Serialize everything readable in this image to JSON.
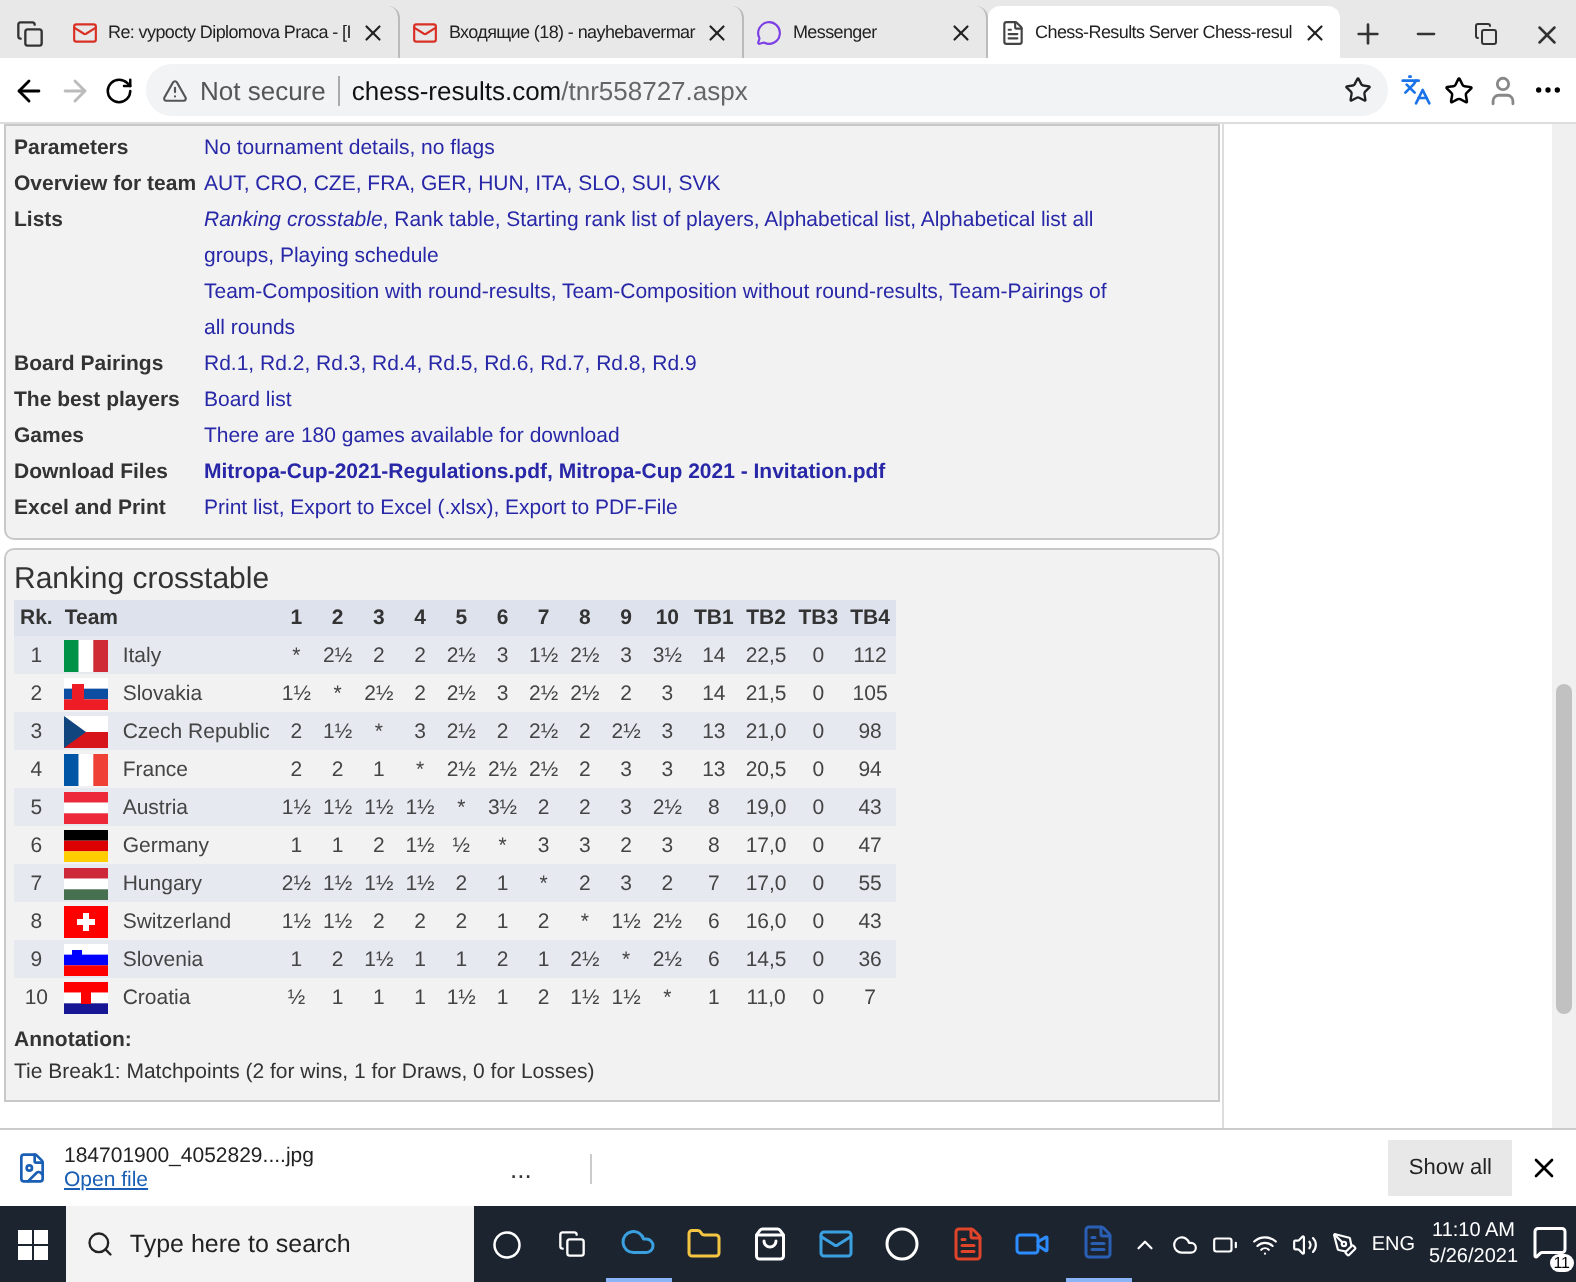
{
  "browser": {
    "tabs": [
      {
        "title": "Re: vypocty Diplomova Praca - [I",
        "selected": false
      },
      {
        "title": "Входящие (18) - nayhebavermar",
        "selected": false
      },
      {
        "title": "Messenger",
        "selected": false
      },
      {
        "title": "Chess-Results Server Chess-resul",
        "selected": true
      }
    ],
    "security": "Not secure",
    "url_host": "chess-results.com",
    "url_path": "/tnr558727.aspx"
  },
  "info_rows": [
    {
      "label": "Parameters",
      "lines": [
        {
          "text": "No tournament details, no flags",
          "bold": false
        }
      ]
    },
    {
      "label": "Overview for team",
      "lines": [
        {
          "text": "AUT, CRO, CZE, FRA, GER, HUN, ITA, SLO, SUI, SVK",
          "bold": false
        }
      ]
    },
    {
      "label": "Lists",
      "lines": [
        {
          "text": "*Ranking crosstable*, Rank table, Starting rank list of players, Alphabetical list, Alphabetical list all groups, Playing schedule",
          "bold": false
        },
        {
          "text": "Team-Composition with round-results, Team-Composition without round-results, Team-Pairings of all rounds",
          "bold": false
        }
      ]
    },
    {
      "label": "Board Pairings",
      "lines": [
        {
          "text": "Rd.1, Rd.2, Rd.3, Rd.4, Rd.5, Rd.6, Rd.7, Rd.8, Rd.9",
          "bold": false
        }
      ]
    },
    {
      "label": "The best players",
      "lines": [
        {
          "text": "Board list",
          "bold": false
        }
      ]
    },
    {
      "label": "Games",
      "lines": [
        {
          "text": "There are 180 games available for download",
          "bold": false
        }
      ]
    },
    {
      "label": "Download Files",
      "lines": [
        {
          "text": "Mitropa-Cup-2021-Regulations.pdf, Mitropa-Cup 2021 - Invitation.pdf",
          "bold": true
        }
      ]
    },
    {
      "label": "Excel and Print",
      "lines": [
        {
          "text": "Print list, Export to Excel (.xlsx), Export to PDF-File",
          "bold": false
        }
      ]
    }
  ],
  "crosstable": {
    "title": "Ranking crosstable",
    "columns": [
      "Rk.",
      "Team",
      "1",
      "2",
      "3",
      "4",
      "5",
      "6",
      "7",
      "8",
      "9",
      "10",
      "TB1",
      "TB2",
      "TB3",
      "TB4"
    ],
    "rows": [
      {
        "cells": [
          "1",
          "Italy",
          "*",
          "2½",
          "2",
          "2",
          "2½",
          "3",
          "1½",
          "2½",
          "3",
          "3½",
          "14",
          "22,5",
          "0",
          "112"
        ]
      },
      {
        "cells": [
          "2",
          "Slovakia",
          "1½",
          "*",
          "2½",
          "2",
          "2½",
          "3",
          "2½",
          "2½",
          "2",
          "3",
          "14",
          "21,5",
          "0",
          "105"
        ]
      },
      {
        "cells": [
          "3",
          "Czech Republic",
          "2",
          "1½",
          "*",
          "3",
          "2½",
          "2",
          "2½",
          "2",
          "2½",
          "3",
          "13",
          "21,0",
          "0",
          "98"
        ]
      },
      {
        "cells": [
          "4",
          "France",
          "2",
          "2",
          "1",
          "*",
          "2½",
          "2½",
          "2½",
          "2",
          "3",
          "3",
          "13",
          "20,5",
          "0",
          "94"
        ]
      },
      {
        "cells": [
          "5",
          "Austria",
          "1½",
          "1½",
          "1½",
          "1½",
          "*",
          "3½",
          "2",
          "2",
          "3",
          "2½",
          "8",
          "19,0",
          "0",
          "43"
        ]
      },
      {
        "cells": [
          "6",
          "Germany",
          "1",
          "1",
          "2",
          "1½",
          "½",
          "*",
          "3",
          "3",
          "2",
          "3",
          "8",
          "17,0",
          "0",
          "47"
        ]
      },
      {
        "cells": [
          "7",
          "Hungary",
          "2½",
          "1½",
          "1½",
          "1½",
          "2",
          "1",
          "*",
          "2",
          "3",
          "2",
          "7",
          "17,0",
          "0",
          "55"
        ]
      },
      {
        "cells": [
          "8",
          "Switzerland",
          "1½",
          "1½",
          "2",
          "2",
          "2",
          "1",
          "2",
          "*",
          "1½",
          "2½",
          "6",
          "16,0",
          "0",
          "43"
        ]
      },
      {
        "cells": [
          "9",
          "Slovenia",
          "1",
          "2",
          "1½",
          "1",
          "1",
          "2",
          "1",
          "2½",
          "*",
          "2½",
          "6",
          "14,5",
          "0",
          "36"
        ]
      },
      {
        "cells": [
          "10",
          "Croatia",
          "½",
          "1",
          "1",
          "1",
          "1½",
          "1",
          "2",
          "1½",
          "1½",
          "*",
          "1",
          "11,0",
          "0",
          "7"
        ]
      }
    ]
  },
  "annotation": {
    "title": "Annotation:",
    "lines": [
      "Tie Break1: Matchpoints (2 for wins, 1 for Draws, 0 for Losses)"
    ]
  },
  "download": {
    "file": "184701900_4052829....jpg",
    "action": "Open file",
    "more": "...",
    "show_all": "Show all"
  },
  "taskbar": {
    "search_placeholder": "Type here to search",
    "language": "ENG",
    "time": "11:10 AM",
    "date": "5/26/2021",
    "notifications": "11"
  }
}
